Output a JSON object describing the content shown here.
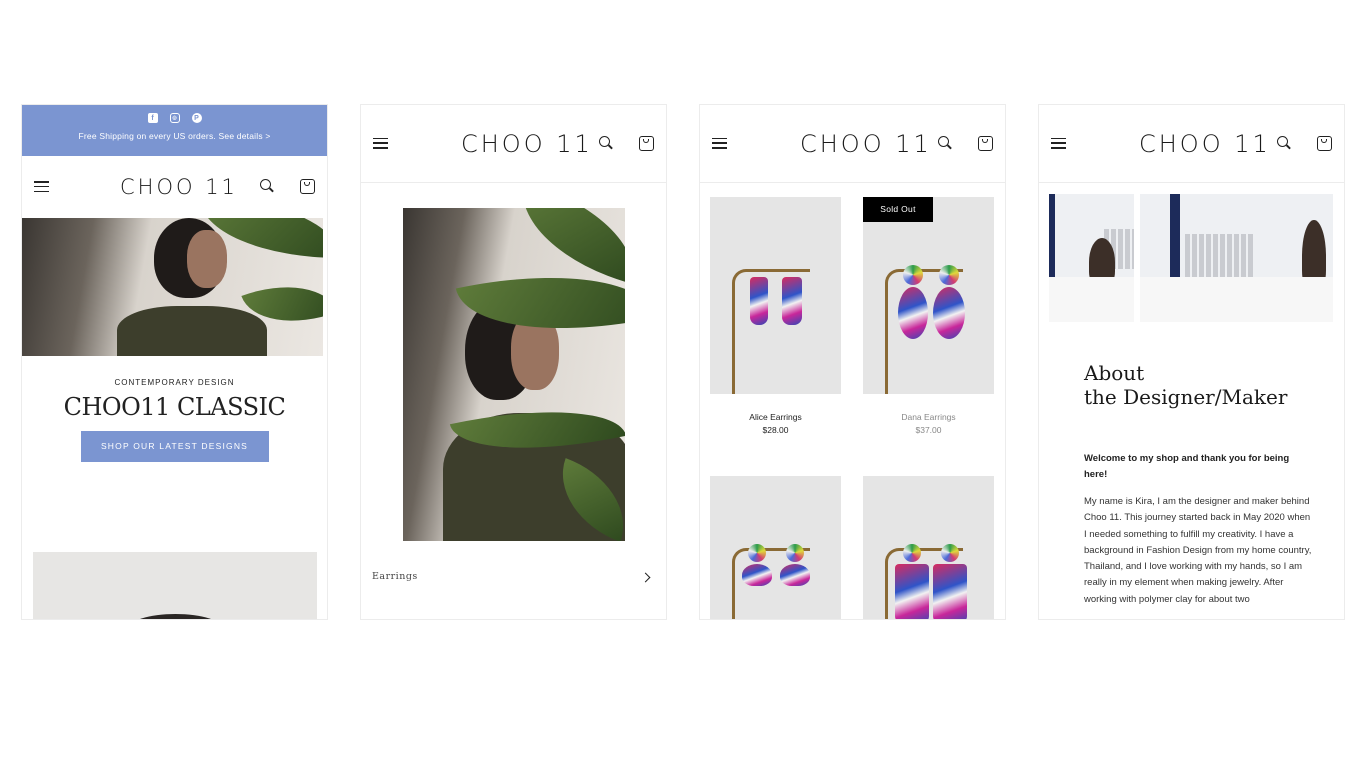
{
  "brand": {
    "logo": "CHOO 11",
    "accent": "#7b95d1"
  },
  "icons": {
    "menu": "hamburger-icon",
    "search": "search-icon",
    "cart": "cart-icon",
    "chevron": "chevron-right-icon",
    "social": [
      "facebook-icon",
      "instagram-icon",
      "pinterest-icon"
    ]
  },
  "home": {
    "social": {
      "facebook": "f",
      "instagram": "◎",
      "pinterest": "P"
    },
    "announcement": "Free Shipping on every US orders. See details >",
    "eyebrow": "CONTEMPORARY DESIGN",
    "title": "CHOO11 CLASSIC",
    "cta": "SHOP OUR LATEST DESIGNS"
  },
  "collection": {
    "category": "Earrings"
  },
  "shop": {
    "products": [
      {
        "name": "Alice Earrings",
        "price": "$28.00",
        "sold_out": false
      },
      {
        "name": "Dana Earrings",
        "price": "$37.00",
        "sold_out": true,
        "badge": "Sold Out"
      }
    ]
  },
  "about": {
    "title_line1": "About",
    "title_line2": "the Designer/Maker",
    "intro": "Welcome to my shop and thank you for being here!",
    "body": "My name is Kira, I am the designer and maker behind Choo 11. This journey started back in May 2020 when I needed something to fulfill my creativity. I have a background in Fashion Design from my home country, Thailand, and I love working with my hands, so I am really in my element when making jewelry. After working with polymer clay for about two"
  }
}
